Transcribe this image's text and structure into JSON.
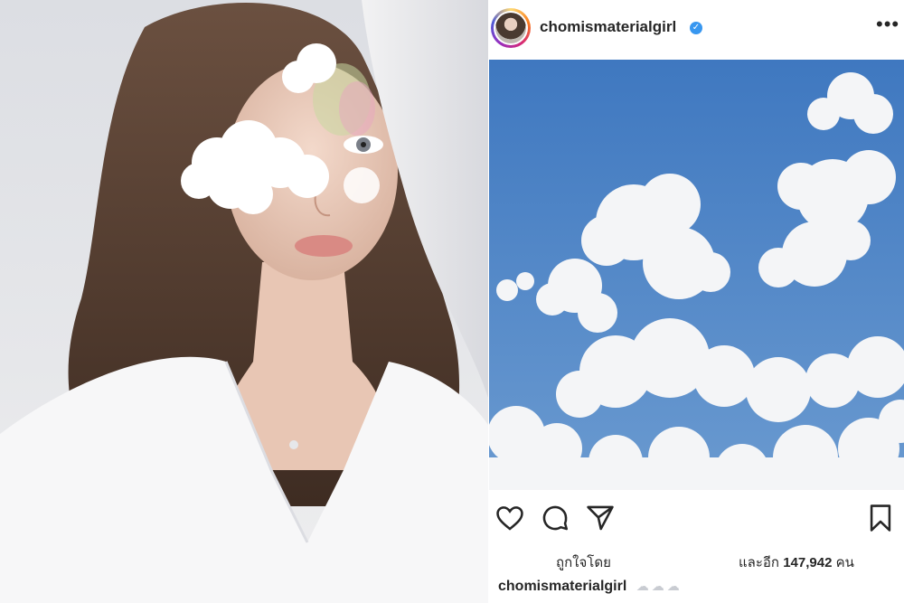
{
  "left_photo": {
    "icon": "portrait-photo"
  },
  "post": {
    "username": "chomismaterialgirl",
    "verified_icon": "verified-badge-icon",
    "verified_glyph": "✓",
    "more_icon": "more-options-icon",
    "more_glyph": "•••"
  },
  "actions": {
    "like_icon": "heart-icon",
    "comment_icon": "comment-icon",
    "share_icon": "send-icon",
    "save_icon": "bookmark-icon"
  },
  "likes": {
    "prefix": "ถูกใจโดย",
    "suffix_text": "และอีก",
    "count": "147,942",
    "unit": "คน"
  },
  "caption": {
    "username": "chomismaterialgirl",
    "emoji": "☁☁☁"
  },
  "colors": {
    "sky": "#4f86c6",
    "verified": "#3897f0",
    "text": "#262626"
  }
}
